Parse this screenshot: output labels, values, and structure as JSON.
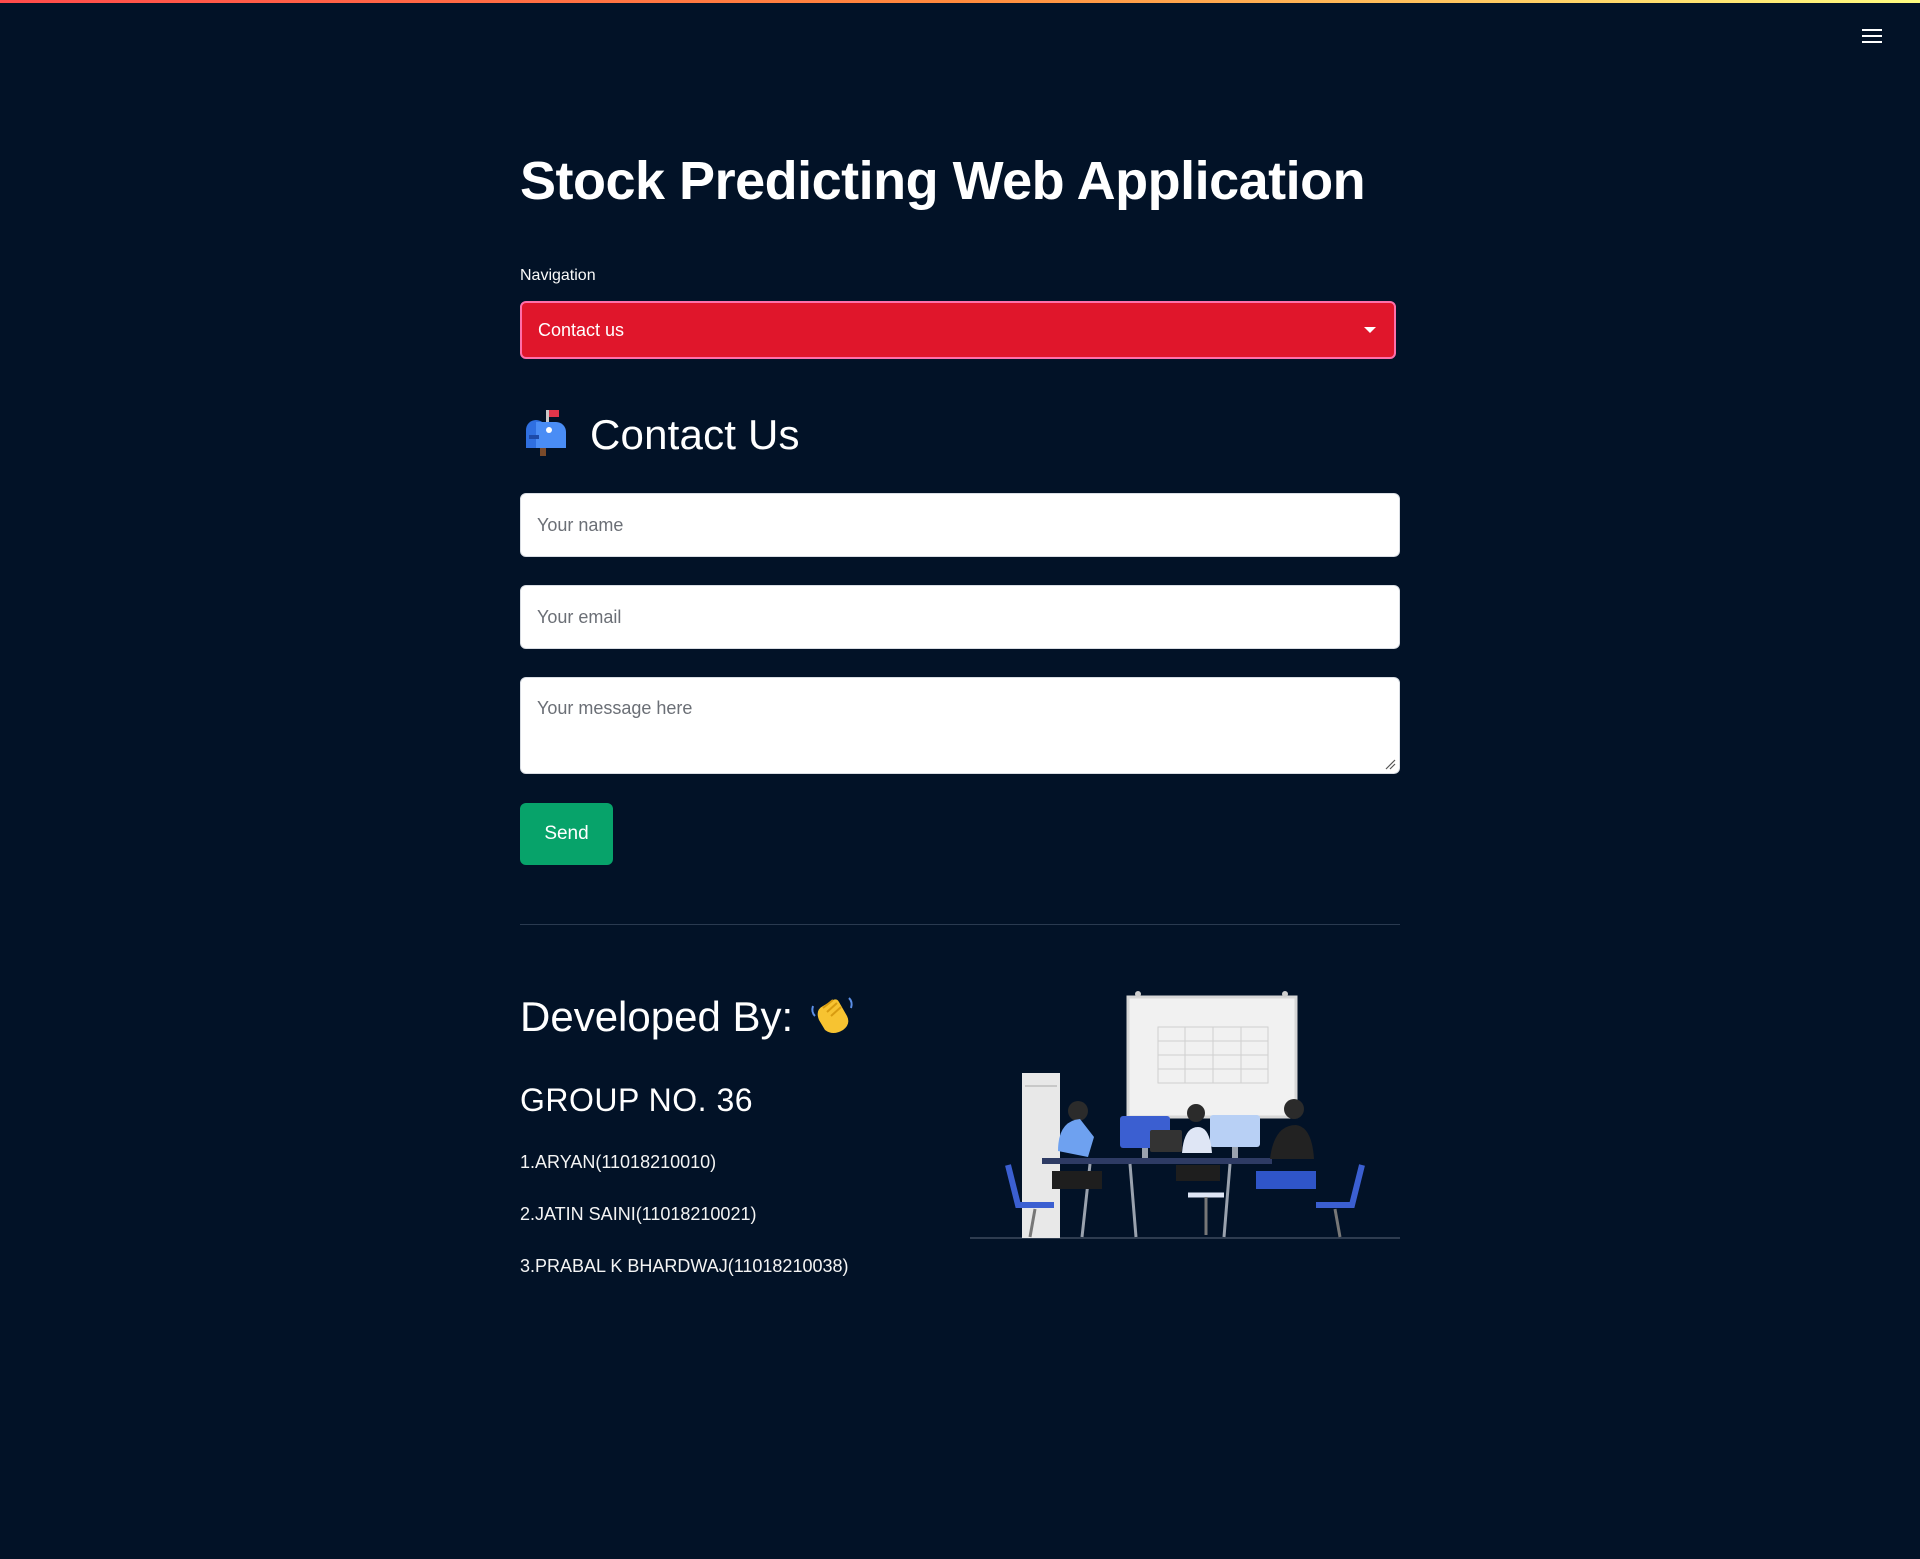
{
  "app": {
    "title": "Stock Predicting Web Application",
    "menu_icon": "hamburger-menu-icon",
    "accent_gradient": [
      "#ff4b4b",
      "#fffd80"
    ],
    "background": "#021227"
  },
  "navigation": {
    "label": "Navigation",
    "selected": "Contact us",
    "color": "#e0162b"
  },
  "contact": {
    "heading": "Contact Us",
    "icon": "mailbox-icon",
    "name_placeholder": "Your name",
    "email_placeholder": "Your email",
    "message_placeholder": "Your message here",
    "send_label": "Send",
    "send_color": "#07a36a"
  },
  "developers": {
    "heading": "Developed By:",
    "icon": "waving-hand-icon",
    "group": "GROUP NO. 36",
    "members": [
      "1.ARYAN(11018210010)",
      "2.JATIN SAINI(11018210021)",
      "3.PRABAL K BHARDWAJ(11018210038)"
    ],
    "illustration": "team-meeting-illustration"
  }
}
